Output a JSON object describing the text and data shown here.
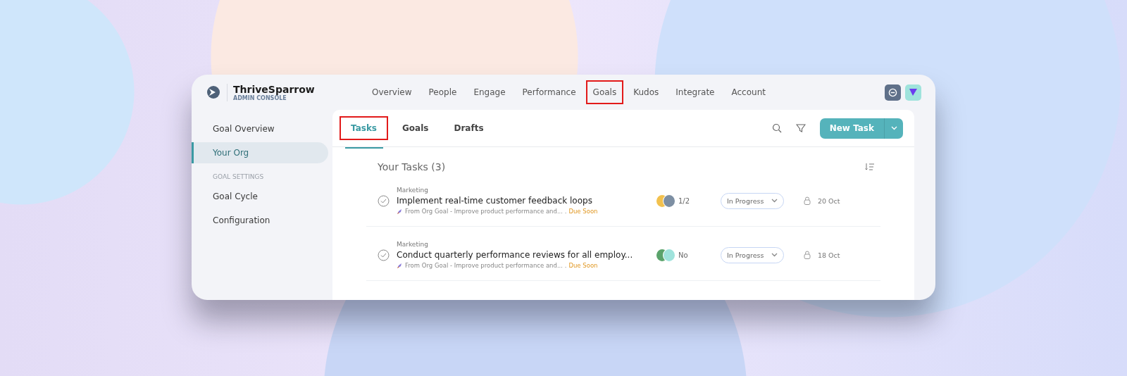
{
  "brand": {
    "name": "ThriveSparrow",
    "subtitle": "ADMIN CONSOLE"
  },
  "nav": [
    {
      "label": "Overview",
      "highlighted": false
    },
    {
      "label": "People",
      "highlighted": false
    },
    {
      "label": "Engage",
      "highlighted": false
    },
    {
      "label": "Performance",
      "highlighted": false
    },
    {
      "label": "Goals",
      "highlighted": true
    },
    {
      "label": "Kudos",
      "highlighted": false
    },
    {
      "label": "Integrate",
      "highlighted": false
    },
    {
      "label": "Account",
      "highlighted": false
    }
  ],
  "sidebar": {
    "items": [
      {
        "kind": "item",
        "label": "Goal Overview",
        "selected": false
      },
      {
        "kind": "item",
        "label": "Your Org",
        "selected": true
      },
      {
        "kind": "heading",
        "label": "GOAL SETTINGS"
      },
      {
        "kind": "item",
        "label": "Goal Cycle",
        "selected": false
      },
      {
        "kind": "item",
        "label": "Configuration",
        "selected": false
      }
    ]
  },
  "tabs": [
    {
      "label": "Tasks",
      "selected": true,
      "highlighted": true
    },
    {
      "label": "Goals",
      "selected": false,
      "highlighted": false
    },
    {
      "label": "Drafts",
      "selected": false,
      "highlighted": false
    }
  ],
  "new_task_button": "New Task",
  "list_title": "Your Tasks (3)",
  "tasks": [
    {
      "category": "Marketing",
      "title": "Implement real-time customer feedback loops",
      "source": "From Org Goal - Improve product performance and... .",
      "due": "Due Soon",
      "assignees": [
        {
          "color": "#f2c14e"
        },
        {
          "color": "#7d8fa3"
        }
      ],
      "progress": "1/2",
      "status": "In Progress",
      "date": "20 Oct"
    },
    {
      "category": "Marketing",
      "title": "Conduct quarterly performance reviews for all employ...",
      "source": "From Org Goal - Improve product performance and... .",
      "due": "Due Soon",
      "assignees": [
        {
          "color": "#5aa36b"
        },
        {
          "color": "#9fe3dc"
        }
      ],
      "progress": "No",
      "status": "In Progress",
      "date": "18 Oct"
    }
  ]
}
